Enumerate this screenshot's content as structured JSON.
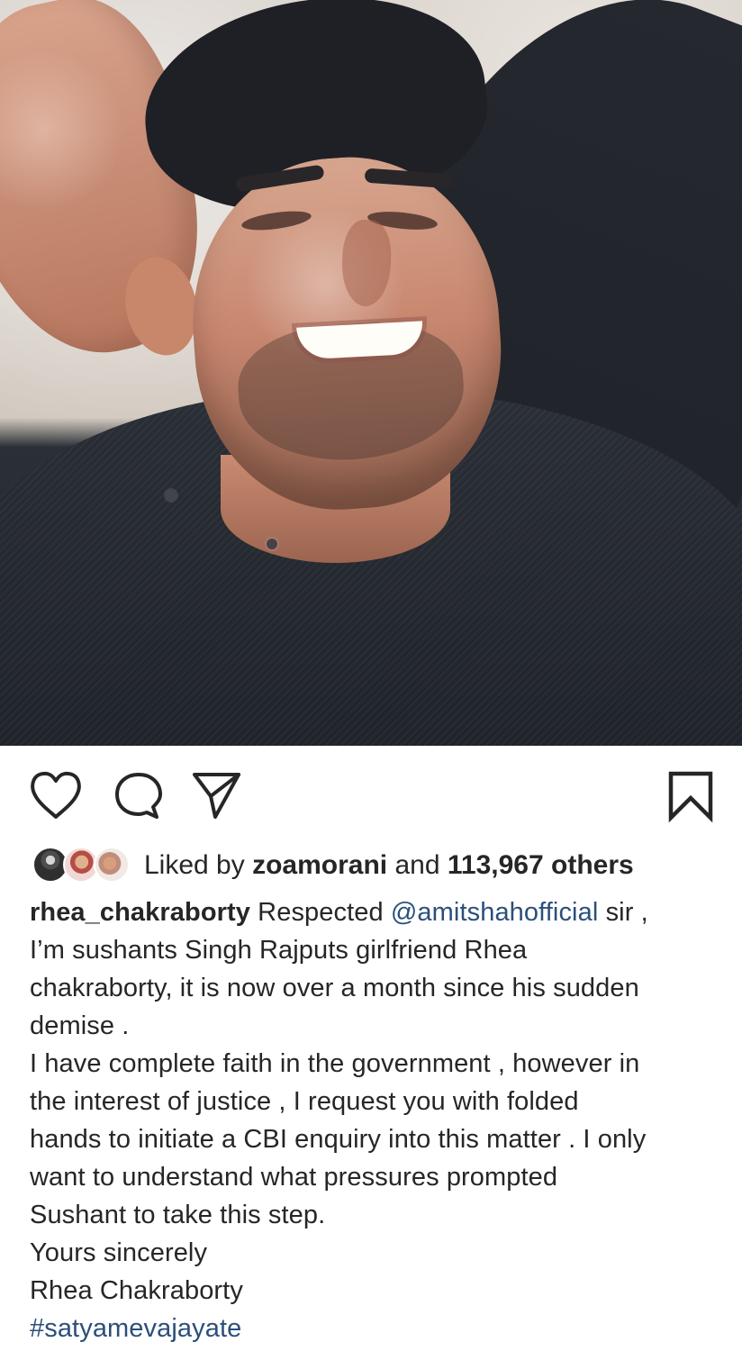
{
  "post": {
    "actions": {
      "like_icon": "heart-outline-icon",
      "comment_icon": "comment-bubble-icon",
      "share_icon": "paper-plane-icon",
      "save_icon": "bookmark-outline-icon"
    },
    "likes": {
      "prefix": "Liked by",
      "liked_user": "zoamorani",
      "connector": "and",
      "count_text": "113,967 others"
    },
    "caption": {
      "username": "rhea_chakraborty",
      "line1_before_mention": "Respected",
      "mention": "@amitshahofficial",
      "line1_after_mention": "sir ,",
      "lines": [
        "I’m sushants Singh Rajputs girlfriend Rhea",
        "chakraborty, it is now over a month since his sudden",
        "demise .",
        "I have complete faith in the government , however in",
        "the interest of justice , I request you with folded",
        "hands to initiate a CBI enquiry into this matter . I only",
        "want to understand what pressures  prompted",
        "Sushant to take this step.",
        "Yours sincerely",
        "Rhea Chakraborty"
      ],
      "hashtag": "#satyamevajayate"
    },
    "colors": {
      "text": "#262626",
      "link": "#2b4f7b",
      "background": "#ffffff"
    }
  }
}
